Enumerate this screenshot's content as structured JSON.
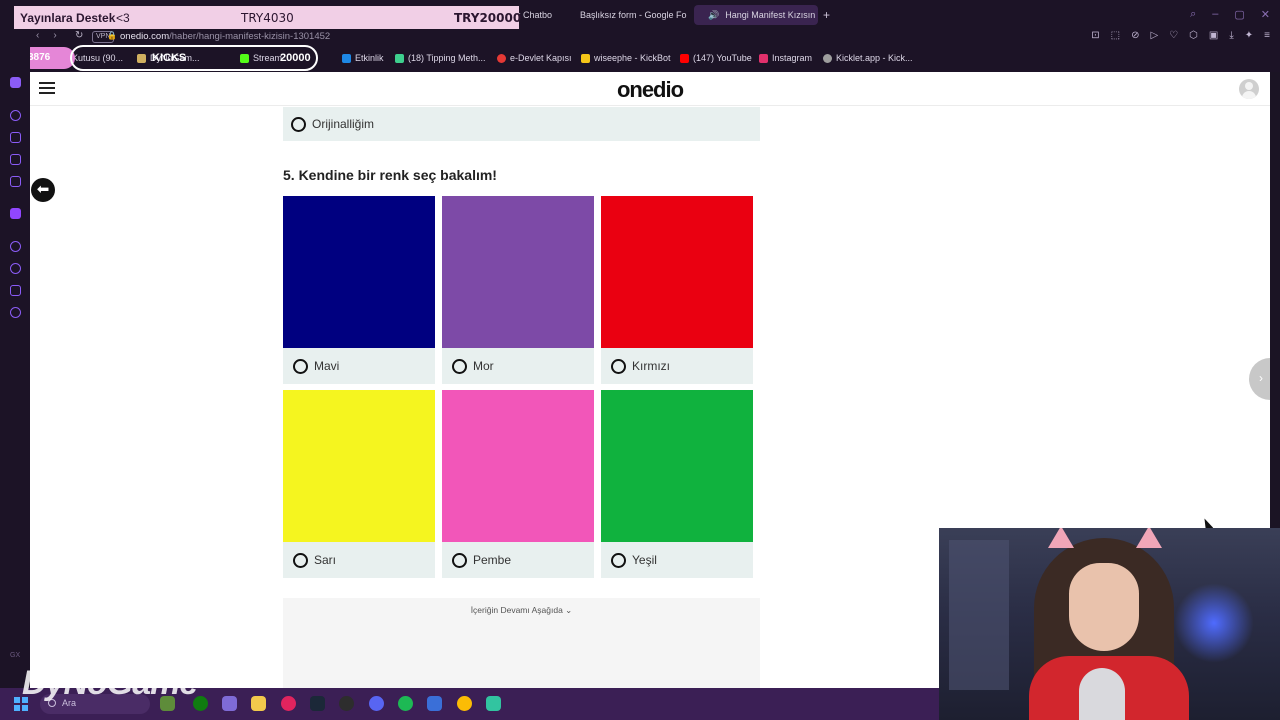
{
  "browser": {
    "tabs": [
      {
        "label": "k Chatbo",
        "color": "#1f1f1f"
      },
      {
        "label": "Başlıksız form - Google Fo",
        "color": "#7c4dff"
      },
      {
        "label": "Hangi Manifest Kızısın",
        "color": "#8b5cf6",
        "active": true
      }
    ],
    "new_tab": "+",
    "vpn": "VPN",
    "url_main": "onedio.com",
    "url_path": "/haber/hangi-manifest-kizisin-1301452",
    "bookmarks": [
      {
        "label": "Kutusu (90...",
        "color": "#d0b060"
      },
      {
        "label": "DyNoGam...",
        "color": "#c0c0c0"
      },
      {
        "label": "Stream...",
        "color": "#53fc18"
      },
      {
        "label": "Etkinlik",
        "color": "#1e88e5"
      },
      {
        "label": "(18) Tipping Meth...",
        "color": "#3ecf8e"
      },
      {
        "label": "e-Devlet Kapısı",
        "color": "#e53935"
      },
      {
        "label": "wiseephe - KickBot",
        "color": "#f5c518"
      },
      {
        "label": "(147) YouTube",
        "color": "#ff0000"
      },
      {
        "label": "Instagram",
        "color": "#e1306c"
      },
      {
        "label": "Kicklet.app - Kick...",
        "color": "#9e9e9e"
      }
    ]
  },
  "overlay": {
    "support_label": "Yayınlara Destek",
    "support_heart": "<3",
    "support_current": "TRY4030",
    "support_goal": "TRY20000",
    "counter": "3876",
    "kicks_label": "KICKS",
    "stream_goal": "20000"
  },
  "site": {
    "logo": "onedio",
    "prev_option": "Orijinalliğim",
    "question": "5. Kendine bir renk seç bakalım!",
    "options": [
      {
        "label": "Mavi",
        "color": "#000080"
      },
      {
        "label": "Mor",
        "color": "#7d4aa7"
      },
      {
        "label": "Kırmızı",
        "color": "#ea0011"
      },
      {
        "label": "Sarı",
        "color": "#f5f51f"
      },
      {
        "label": "Pembe",
        "color": "#f256b9"
      },
      {
        "label": "Yeşil",
        "color": "#10b23e"
      }
    ],
    "continue_text": "İçeriğin Devamı Aşağıda ⌄"
  },
  "taskbar": {
    "search_label": "Ara",
    "watermark": "DyNoGame"
  }
}
